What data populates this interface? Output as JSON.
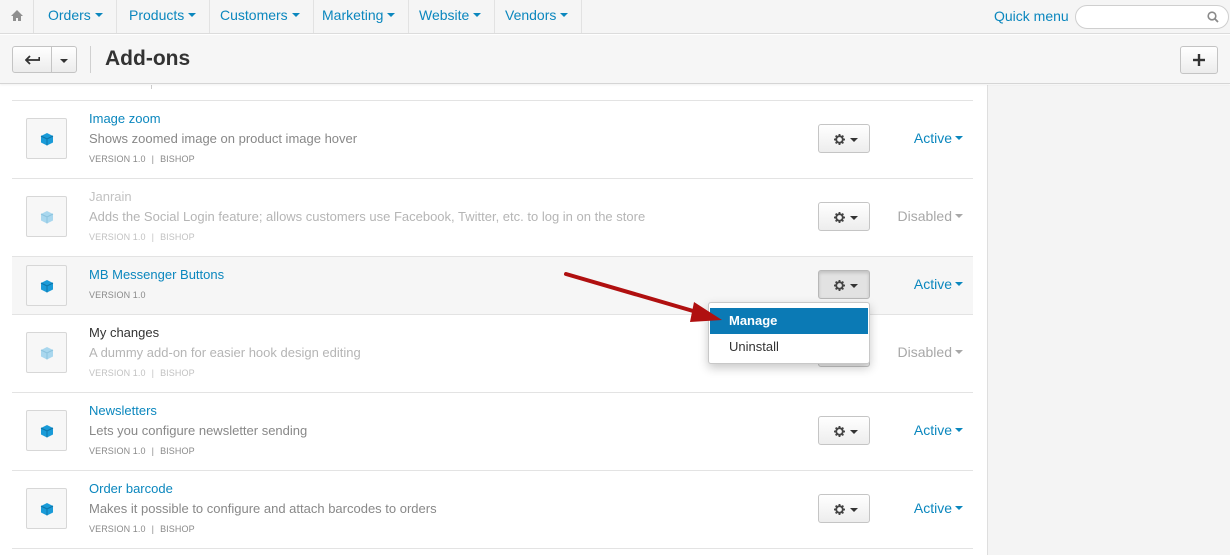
{
  "nav": {
    "items": [
      "Orders",
      "Products",
      "Customers",
      "Marketing",
      "Website",
      "Vendors"
    ],
    "quick_menu": "Quick menu",
    "search_placeholder": ""
  },
  "header": {
    "title": "Add-ons"
  },
  "addons": [
    {
      "name": "Image zoom",
      "description": "Shows zoomed image on product image hover",
      "version": "VERSION 1.0",
      "author": "BISHOP",
      "status": "Active"
    },
    {
      "name": "Janrain",
      "description": "Adds the Social Login feature; allows customers use Facebook, Twitter, etc. to log in on the store",
      "version": "VERSION 1.0",
      "author": "BISHOP",
      "status": "Disabled"
    },
    {
      "name": "MB Messenger Buttons",
      "description": "",
      "version": "VERSION 1.0",
      "author": "",
      "status": "Active"
    },
    {
      "name": "My changes",
      "description": "A dummy add-on for easier hook design editing",
      "version": "VERSION 1.0",
      "author": "BISHOP",
      "status": "Disabled"
    },
    {
      "name": "Newsletters",
      "description": "Lets you configure newsletter sending",
      "version": "VERSION 1.0",
      "author": "BISHOP",
      "status": "Active"
    },
    {
      "name": "Order barcode",
      "description": "Makes it possible to configure and attach barcodes to orders",
      "version": "VERSION 1.0",
      "author": "BISHOP",
      "status": "Active"
    }
  ],
  "menu": {
    "items": [
      "Manage",
      "Uninstall"
    ]
  },
  "colors": {
    "link": "#0b87be",
    "menu_highlight": "#0b7ab5",
    "arrow": "#b01010"
  }
}
